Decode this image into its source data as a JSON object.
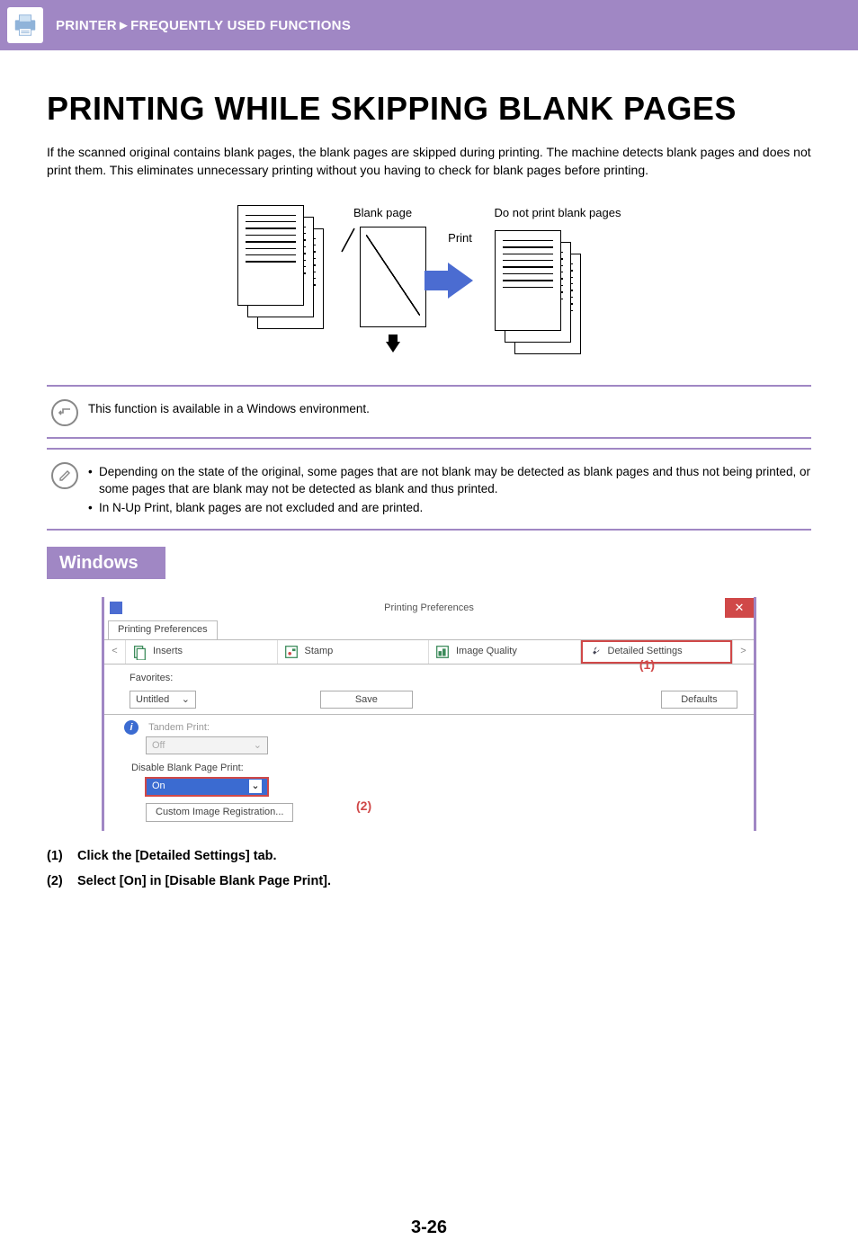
{
  "banner": {
    "section": "PRINTER",
    "separator": "►",
    "subsection": "FREQUENTLY USED FUNCTIONS"
  },
  "title": "PRINTING WHILE SKIPPING BLANK PAGES",
  "intro": "If the scanned original contains blank pages, the blank pages are skipped during printing. The machine detects blank pages and does not print them. This eliminates unnecessary printing without you having to check for blank pages before printing.",
  "diagram": {
    "blank_page_label": "Blank page",
    "print_label": "Print",
    "right_label": "Do not print blank pages"
  },
  "note1": "This function is available in a Windows environment.",
  "note2": {
    "b1": "Depending on the state of the original, some pages that are not blank may be detected as blank pages and thus not being printed, or some pages that are blank may not be detected as blank and thus printed.",
    "b2": "In N-Up Print, blank pages are not excluded and are printed."
  },
  "windows_heading": "Windows",
  "dialog": {
    "title": "Printing Preferences",
    "tabstrip": "Printing Preferences",
    "tabs": {
      "inserts": "Inserts",
      "stamp": "Stamp",
      "image_quality": "Image Quality",
      "detailed_settings": "Detailed Settings"
    },
    "favorites_label": "Favorites:",
    "favorites_value": "Untitled",
    "save_btn": "Save",
    "defaults_btn": "Defaults",
    "tandem_label": "Tandem Print:",
    "tandem_value": "Off",
    "disable_label": "Disable Blank Page Print:",
    "disable_value": "On",
    "custom_image_btn": "Custom Image Registration...",
    "callout1": "(1)",
    "callout2": "(2)"
  },
  "steps": {
    "s1_num": "(1)",
    "s1": "Click the [Detailed Settings] tab.",
    "s2_num": "(2)",
    "s2": "Select [On] in [Disable Blank Page Print]."
  },
  "page_number": "3-26"
}
